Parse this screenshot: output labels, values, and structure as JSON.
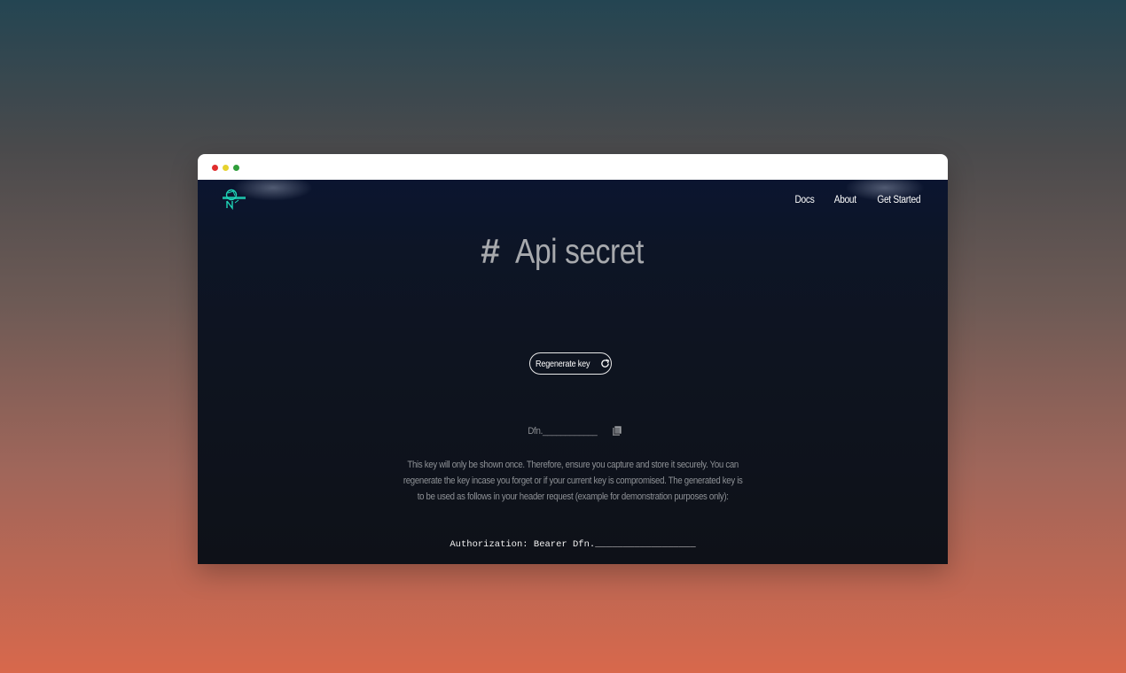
{
  "window": {
    "controls": [
      "close",
      "minimize",
      "maximize"
    ]
  },
  "header": {
    "logo_icon": "robot-logo-icon",
    "nav": [
      {
        "label": "Docs"
      },
      {
        "label": "About"
      },
      {
        "label": "Get Started"
      }
    ]
  },
  "main": {
    "title_hash": "#",
    "title": "Api secret",
    "regenerate_label": "Regenerate key",
    "regenerate_icon": "refresh-icon",
    "key_value": "Dfn.____________",
    "copy_icon": "copy-icon",
    "description": "This key will only be shown once. Therefore, ensure you capture and store it securely. You can regenerate the key incase you forget or if your current key is compromised. The generated key is to be used as follows in your header request (example for demonstration purposes only):",
    "auth_example": "Authorization: Bearer Dfn.__________________"
  },
  "colors": {
    "accent_logo": "#1fd6b8",
    "background_top": "#0b1530",
    "background_bottom": "#0e1118",
    "title_text": "#a7a9ad"
  }
}
